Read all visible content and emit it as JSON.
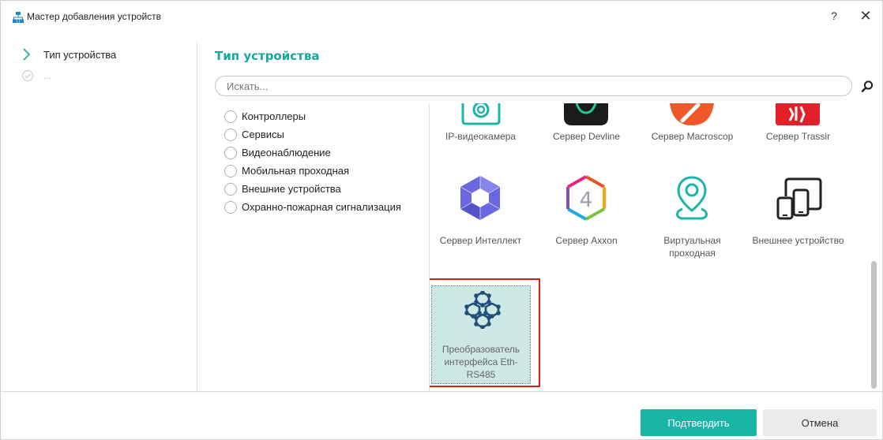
{
  "window": {
    "title": "Мастер добавления устройств",
    "help_label": "?",
    "close_label": "✕"
  },
  "steps": [
    {
      "label": "Тип устройства",
      "state": "current"
    },
    {
      "label": "...",
      "state": "pending"
    }
  ],
  "main": {
    "section_title": "Тип устройства",
    "search": {
      "placeholder": "Искать...",
      "value": ""
    }
  },
  "categories": [
    {
      "label": "Контроллеры"
    },
    {
      "label": "Сервисы"
    },
    {
      "label": "Видеонаблюдение"
    },
    {
      "label": "Мобильная проходная"
    },
    {
      "label": "Внешние устройства"
    },
    {
      "label": "Охранно-пожарная сигнализация"
    }
  ],
  "devices": [
    {
      "label": "IP-видеокамера",
      "icon": "ip-camera-icon"
    },
    {
      "label": "Сервер Devline",
      "icon": "devline-logo-icon"
    },
    {
      "label": "Сервер Macroscop",
      "icon": "macroscop-logo-icon"
    },
    {
      "label": "Сервер Trassir",
      "icon": "trassir-logo-icon"
    },
    {
      "label": "Сервер Интеллект",
      "icon": "intellect-logo-icon"
    },
    {
      "label": "Сервер Axxon",
      "icon": "axxon-logo-icon"
    },
    {
      "label": "Виртуальная проходная",
      "icon": "location-pin-icon"
    },
    {
      "label": "Внешнее устройство",
      "icon": "devices-icon"
    },
    {
      "label": "Преобразователь интерфейса Eth-RS485",
      "icon": "network-hex-icon",
      "selected": true
    }
  ],
  "footer": {
    "confirm_label": "Подтвердить",
    "cancel_label": "Отмена"
  },
  "colors": {
    "accent": "#19b5a7",
    "title_accent": "#14a8a0",
    "selected_tile_bg": "#cde8e5",
    "highlight_border": "#e01b1b",
    "devline_green": "#22c98d",
    "macroscop_orange": "#f0572a",
    "trassir_red": "#e2202a",
    "intellect_purple": "#6b67e0",
    "icon_dark_blue": "#1f4f7a"
  }
}
